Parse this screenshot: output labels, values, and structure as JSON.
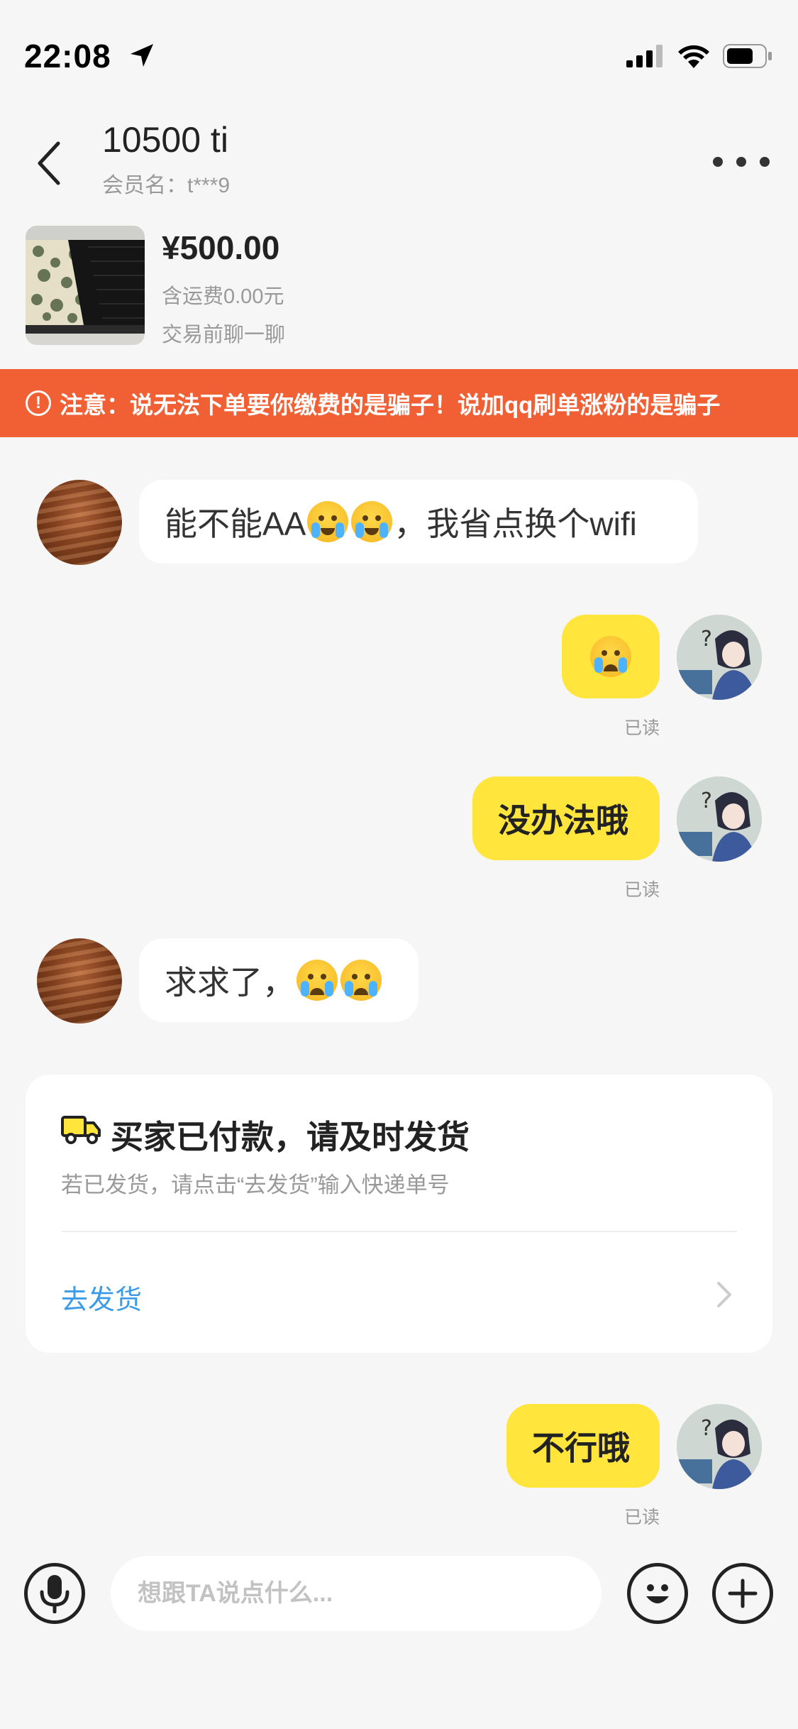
{
  "status_bar": {
    "time": "22:08"
  },
  "header": {
    "title": "10500 ti",
    "member_label": "会员名：t***9"
  },
  "product": {
    "price": "¥500.00",
    "shipping": "含运费0.00元",
    "note": "交易前聊一聊"
  },
  "warning": {
    "icon": "!",
    "text": "注意：说无法下单要你缴费的是骗子！说加qq刷单涨粉的是骗子"
  },
  "messages": [
    {
      "side": "left",
      "text_before": "能不能AA",
      "emojis": [
        "grin-sweat",
        "grin-sweat"
      ],
      "text_after": "，我省点换个wifi"
    },
    {
      "side": "right",
      "emoji": "crying",
      "read": "已读"
    },
    {
      "side": "right",
      "text": "没办法哦",
      "read": "已读"
    },
    {
      "side": "left",
      "text_before": "求求了，",
      "emojis": [
        "crying",
        "crying"
      ]
    },
    {
      "side": "right",
      "text": "不行哦",
      "read": "已读"
    }
  ],
  "order_card": {
    "title": "买家已付款，请及时发货",
    "subtitle": "若已发货，请点击“去发货”输入快递单号",
    "action": "去发货"
  },
  "input": {
    "placeholder": "想跟TA说点什么..."
  },
  "icons": {
    "back": "chevron-left-icon",
    "more": "more-dots-icon",
    "mic": "microphone-icon",
    "emoji": "emoji-icon",
    "plus": "plus-icon",
    "truck": "truck-icon"
  },
  "colors": {
    "accent": "#ffe53c",
    "warning": "#f16034",
    "link": "#3c9be8"
  }
}
